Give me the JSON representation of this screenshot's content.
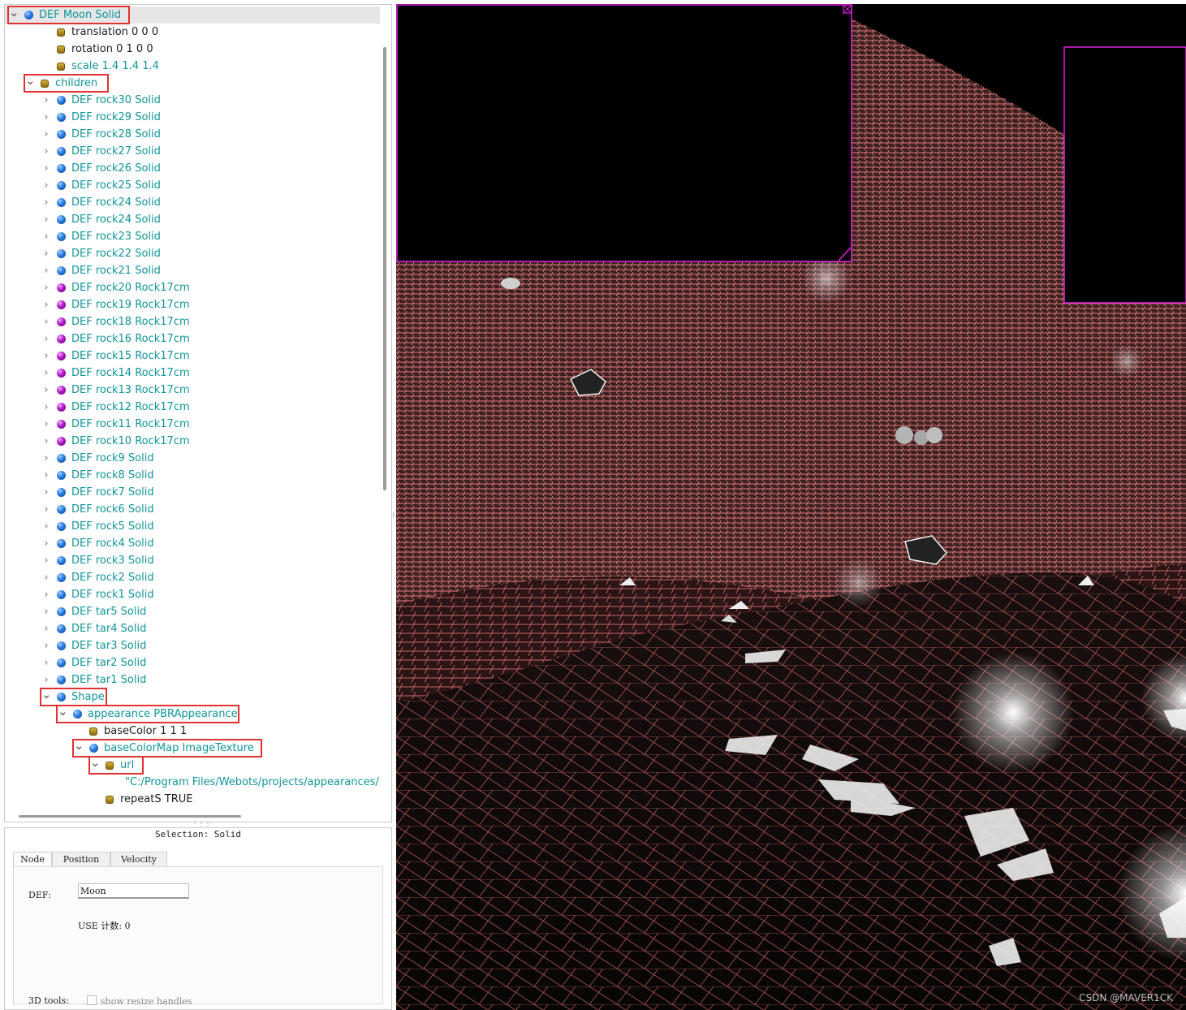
{
  "scene_tree": {
    "items": [
      {
        "level": 0,
        "arrow": "expanded",
        "icon": "blue-node",
        "label": "DEF Moon Solid",
        "kind": "node",
        "selected": true
      },
      {
        "level": 2,
        "arrow": "none",
        "icon": "field",
        "label": "translation 0 0 0",
        "kind": "field"
      },
      {
        "level": 2,
        "arrow": "none",
        "icon": "field",
        "label": "rotation 0 1 0 0",
        "kind": "field"
      },
      {
        "level": 2,
        "arrow": "none",
        "icon": "field",
        "label": "scale 1.4 1.4 1.4",
        "kind": "fieldnode"
      },
      {
        "level": 1,
        "arrow": "expanded",
        "icon": "field",
        "label": "children",
        "kind": "fieldnode"
      },
      {
        "level": 2,
        "arrow": "collapsed",
        "icon": "blue-node",
        "label": "DEF rock30 Solid",
        "kind": "node"
      },
      {
        "level": 2,
        "arrow": "collapsed",
        "icon": "blue-node",
        "label": "DEF rock29 Solid",
        "kind": "node"
      },
      {
        "level": 2,
        "arrow": "collapsed",
        "icon": "blue-node",
        "label": "DEF rock28 Solid",
        "kind": "node"
      },
      {
        "level": 2,
        "arrow": "collapsed",
        "icon": "blue-node",
        "label": "DEF rock27 Solid",
        "kind": "node"
      },
      {
        "level": 2,
        "arrow": "collapsed",
        "icon": "blue-node",
        "label": "DEF rock26 Solid",
        "kind": "node"
      },
      {
        "level": 2,
        "arrow": "collapsed",
        "icon": "blue-node",
        "label": "DEF rock25 Solid",
        "kind": "node"
      },
      {
        "level": 2,
        "arrow": "collapsed",
        "icon": "blue-node",
        "label": "DEF rock24 Solid",
        "kind": "node"
      },
      {
        "level": 2,
        "arrow": "collapsed",
        "icon": "blue-node",
        "label": "DEF rock24 Solid",
        "kind": "node"
      },
      {
        "level": 2,
        "arrow": "collapsed",
        "icon": "blue-node",
        "label": "DEF rock23 Solid",
        "kind": "node"
      },
      {
        "level": 2,
        "arrow": "collapsed",
        "icon": "blue-node",
        "label": "DEF rock22 Solid",
        "kind": "node"
      },
      {
        "level": 2,
        "arrow": "collapsed",
        "icon": "blue-node",
        "label": "DEF rock21 Solid",
        "kind": "node"
      },
      {
        "level": 2,
        "arrow": "collapsed",
        "icon": "purple-node",
        "label": "DEF rock20 Rock17cm",
        "kind": "node"
      },
      {
        "level": 2,
        "arrow": "collapsed",
        "icon": "purple-node",
        "label": "DEF rock19 Rock17cm",
        "kind": "node"
      },
      {
        "level": 2,
        "arrow": "collapsed",
        "icon": "purple-node",
        "label": "DEF rock18 Rock17cm",
        "kind": "node"
      },
      {
        "level": 2,
        "arrow": "collapsed",
        "icon": "purple-node",
        "label": "DEF rock16 Rock17cm",
        "kind": "node"
      },
      {
        "level": 2,
        "arrow": "collapsed",
        "icon": "purple-node",
        "label": "DEF rock15 Rock17cm",
        "kind": "node"
      },
      {
        "level": 2,
        "arrow": "collapsed",
        "icon": "purple-node",
        "label": "DEF rock14 Rock17cm",
        "kind": "node"
      },
      {
        "level": 2,
        "arrow": "collapsed",
        "icon": "purple-node",
        "label": "DEF rock13 Rock17cm",
        "kind": "node"
      },
      {
        "level": 2,
        "arrow": "collapsed",
        "icon": "purple-node",
        "label": "DEF rock12 Rock17cm",
        "kind": "node"
      },
      {
        "level": 2,
        "arrow": "collapsed",
        "icon": "purple-node",
        "label": "DEF rock11 Rock17cm",
        "kind": "node"
      },
      {
        "level": 2,
        "arrow": "collapsed",
        "icon": "purple-node",
        "label": "DEF rock10 Rock17cm",
        "kind": "node"
      },
      {
        "level": 2,
        "arrow": "collapsed",
        "icon": "blue-node",
        "label": "DEF rock9 Solid",
        "kind": "node"
      },
      {
        "level": 2,
        "arrow": "collapsed",
        "icon": "blue-node",
        "label": "DEF rock8 Solid",
        "kind": "node"
      },
      {
        "level": 2,
        "arrow": "collapsed",
        "icon": "blue-node",
        "label": "DEF rock7 Solid",
        "kind": "node"
      },
      {
        "level": 2,
        "arrow": "collapsed",
        "icon": "blue-node",
        "label": "DEF rock6 Solid",
        "kind": "node"
      },
      {
        "level": 2,
        "arrow": "collapsed",
        "icon": "blue-node",
        "label": "DEF rock5 Solid",
        "kind": "node"
      },
      {
        "level": 2,
        "arrow": "collapsed",
        "icon": "blue-node",
        "label": "DEF rock4 Solid",
        "kind": "node"
      },
      {
        "level": 2,
        "arrow": "collapsed",
        "icon": "blue-node",
        "label": "DEF rock3 Solid",
        "kind": "node"
      },
      {
        "level": 2,
        "arrow": "collapsed",
        "icon": "blue-node",
        "label": "DEF rock2 Solid",
        "kind": "node"
      },
      {
        "level": 2,
        "arrow": "collapsed",
        "icon": "blue-node",
        "label": "DEF rock1 Solid",
        "kind": "node"
      },
      {
        "level": 2,
        "arrow": "collapsed",
        "icon": "blue-node",
        "label": "DEF tar5 Solid",
        "kind": "node"
      },
      {
        "level": 2,
        "arrow": "collapsed",
        "icon": "blue-node",
        "label": "DEF tar4 Solid",
        "kind": "node"
      },
      {
        "level": 2,
        "arrow": "collapsed",
        "icon": "blue-node",
        "label": "DEF tar3 Solid",
        "kind": "node"
      },
      {
        "level": 2,
        "arrow": "collapsed",
        "icon": "blue-node",
        "label": "DEF tar2 Solid",
        "kind": "node"
      },
      {
        "level": 2,
        "arrow": "collapsed",
        "icon": "blue-node",
        "label": "DEF tar1 Solid",
        "kind": "node"
      },
      {
        "level": 2,
        "arrow": "expanded",
        "icon": "blue-node",
        "label": "Shape",
        "kind": "node",
        "highlight": true
      },
      {
        "level": 3,
        "arrow": "expanded",
        "icon": "blue-node",
        "label": "appearance PBRAppearance",
        "kind": "node",
        "highlight": true
      },
      {
        "level": 4,
        "arrow": "none",
        "icon": "field",
        "label": "baseColor 1 1 1",
        "kind": "field"
      },
      {
        "level": 4,
        "arrow": "expanded",
        "icon": "blue-node",
        "label": "baseColorMap ImageTexture",
        "kind": "node",
        "highlight": true
      },
      {
        "level": 5,
        "arrow": "expanded",
        "icon": "field",
        "label": "url",
        "kind": "fieldnode",
        "highlight": true
      },
      {
        "level": 6,
        "arrow": "none",
        "icon": "none",
        "label": "\"C:/Program Files/Webots/projects/appearances/prot",
        "kind": "fieldnode"
      },
      {
        "level": 5,
        "arrow": "none",
        "icon": "field",
        "label": "repeatS TRUE",
        "kind": "field"
      }
    ]
  },
  "editor": {
    "selection_title": "Selection: Solid",
    "tabs": [
      "Node",
      "Position",
      "Velocity"
    ],
    "active_tab": "Node",
    "def_label": "DEF:",
    "def_value": "Moon",
    "use_count": "USE 计数: 0",
    "tools_label": "3D tools:",
    "resize_handles_label": "show resize handles",
    "resize_handles_checked": false
  },
  "view3d": {
    "watermark": "CSDN @MAVER1CK",
    "mesh_color": "#e07a7a",
    "overlay_border_color": "#e020e0"
  }
}
